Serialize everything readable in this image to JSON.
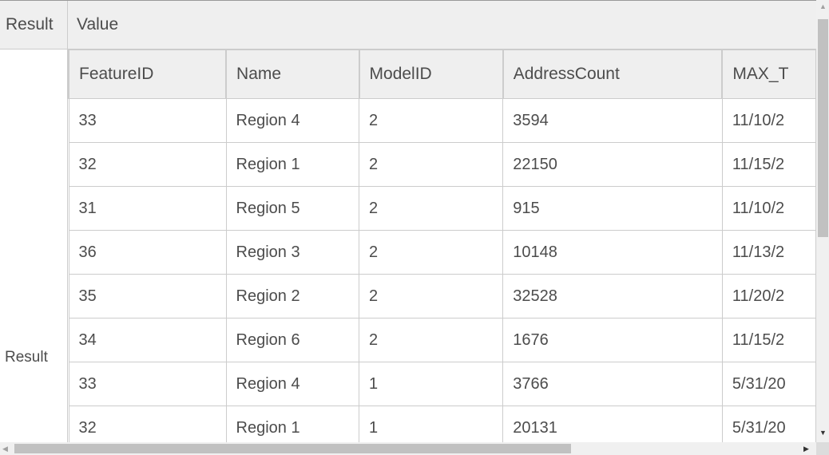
{
  "outer_headers": {
    "result": "Result",
    "value": "Value"
  },
  "row_label": "Result",
  "columns": [
    "FeatureID",
    "Name",
    "ModelID",
    "AddressCount",
    "MAX_T"
  ],
  "rows": [
    [
      "33",
      "Region 4",
      "2",
      "3594",
      "11/10/2"
    ],
    [
      "32",
      "Region 1",
      "2",
      "22150",
      "11/15/2"
    ],
    [
      "31",
      "Region 5",
      "2",
      "915",
      "11/10/2"
    ],
    [
      "36",
      "Region 3",
      "2",
      "10148",
      "11/13/2"
    ],
    [
      "35",
      "Region 2",
      "2",
      "32528",
      "11/20/2"
    ],
    [
      "34",
      "Region 6",
      "2",
      "1676",
      "11/15/2"
    ],
    [
      "33",
      "Region 4",
      "1",
      "3766",
      "5/31/20"
    ],
    [
      "32",
      "Region 1",
      "1",
      "20131",
      "5/31/20"
    ]
  ]
}
